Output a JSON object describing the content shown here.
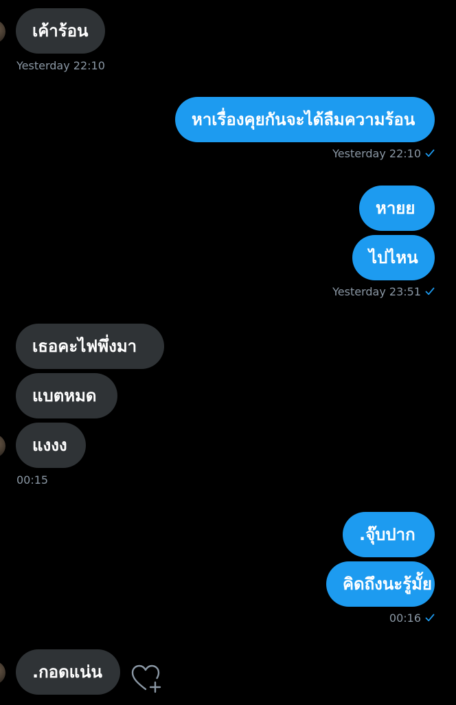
{
  "messages": [
    {
      "side": "in",
      "text": "เค้าร้อน"
    },
    {
      "side": "out",
      "text": "หาเรื่องคุยกันจะได้ลืมความร้อน"
    },
    {
      "side": "out",
      "text": "หายย"
    },
    {
      "side": "out",
      "text": "ไปไหน"
    },
    {
      "side": "in",
      "text": "เธอคะไฟพึ่งมา"
    },
    {
      "side": "in",
      "text": "แบตหมด"
    },
    {
      "side": "in",
      "text": "แงงง"
    },
    {
      "side": "out",
      "text": ".จุ๊บปาก"
    },
    {
      "side": "out",
      "text": "คิดถึงนะรู้มั้ย"
    },
    {
      "side": "in",
      "text": ".กอดแน่น"
    }
  ],
  "timestamps": {
    "t1": "Yesterday 22:10",
    "t2": "Yesterday 22:10",
    "t3": "Yesterday 23:51",
    "t4": "00:15",
    "t5": "00:16"
  },
  "colors": {
    "background": "#000000",
    "incoming_bubble": "#2f3336",
    "outgoing_bubble": "#1d9bf0",
    "timestamp": "#8b98a5",
    "read_check": "#1d9bf0"
  },
  "icons": {
    "read_receipt": "checkmark-icon",
    "react": "heart-plus-icon",
    "avatar": "avatar"
  }
}
